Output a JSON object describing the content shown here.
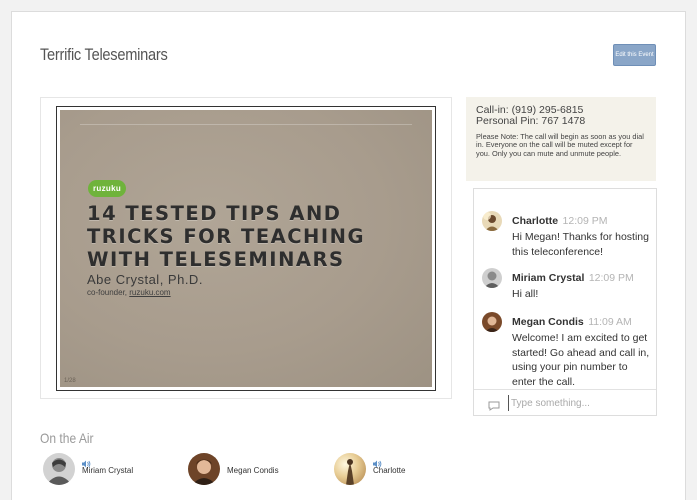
{
  "event": {
    "title": "Terrific Teleseminars",
    "edit_button": "Edit this Event"
  },
  "slide": {
    "brand": "ruzuku",
    "headline_line1": "14 TESTED TIPS AND",
    "headline_line2": "TRICKS FOR TEACHING",
    "headline_line3": "WITH TELESEMINARS",
    "author": "Abe Crystal, Ph.D.",
    "subtitle_prefix": "co-founder, ",
    "subtitle_link": "ruzuku.com",
    "page_number": "1/28"
  },
  "call_info": {
    "callin": "Call-in: (919) 295-6815",
    "pin": "Personal Pin: 767 1478",
    "note": "Please Note: The call will begin as soon as you dial in. Everyone on the call will be muted except for you. Only you can mute and unmute people."
  },
  "chat": {
    "messages": [
      {
        "author": "Charlotte",
        "time": "12:09 PM",
        "text": "Hi Megan! Thanks for hosting this teleconference!"
      },
      {
        "author": "Miriam Crystal",
        "time": "12:09 PM",
        "text": "Hi all!"
      },
      {
        "author": "Megan Condis",
        "time": "11:09 AM",
        "text": "Welcome! I am excited to get started! Go ahead and call in, using your pin number to enter the call."
      }
    ],
    "input_placeholder": "Type something..."
  },
  "on_air": {
    "title": "On the Air",
    "speakers": [
      {
        "name": "Miriam Crystal",
        "icon": "speaker-volume-icon"
      },
      {
        "name": "Megan Condis",
        "icon": "none"
      },
      {
        "name": "Charlotte",
        "icon": "speaker-volume-icon"
      }
    ]
  },
  "colors": {
    "accent_button": "#8aa6c8",
    "call_info_bg": "#f4f2ea",
    "brand_green": "#6fb33b",
    "volume_icon": "#5b8fc7"
  }
}
